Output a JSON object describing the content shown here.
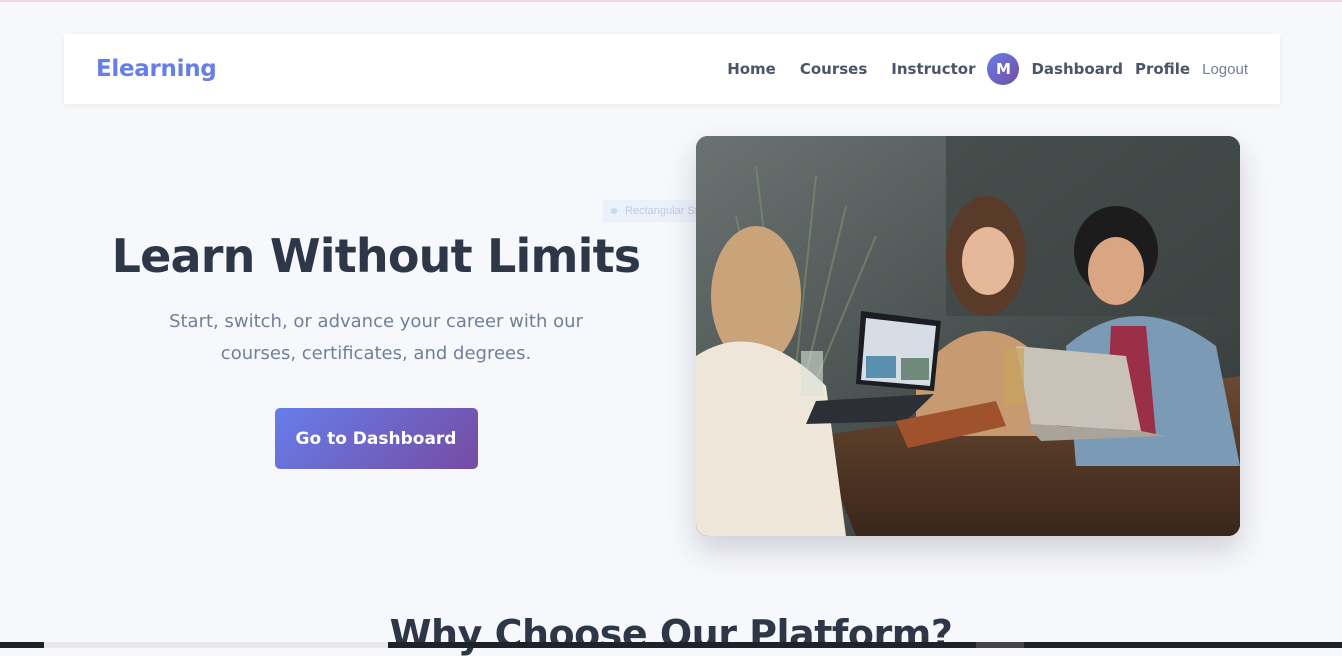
{
  "nav": {
    "brand": "Elearning",
    "links": [
      "Home",
      "Courses",
      "Instructor"
    ],
    "avatar_initial": "M",
    "dashboard": "Dashboard",
    "profile": "Profile",
    "logout": "Logout"
  },
  "hero": {
    "title": "Learn Without Limits",
    "subtitle": "Start, switch, or advance your career with our courses, certificates, and degrees.",
    "cta": "Go to Dashboard",
    "image_alt": "students-collaborating-photo"
  },
  "overlay": {
    "label": "Rectangular Snip"
  },
  "section": {
    "title": "Why Choose Our Platform?"
  },
  "colors": {
    "accent": "#667eea",
    "accent_end": "#764ba2",
    "text_dark": "#2d3748",
    "text_muted": "#718096"
  }
}
